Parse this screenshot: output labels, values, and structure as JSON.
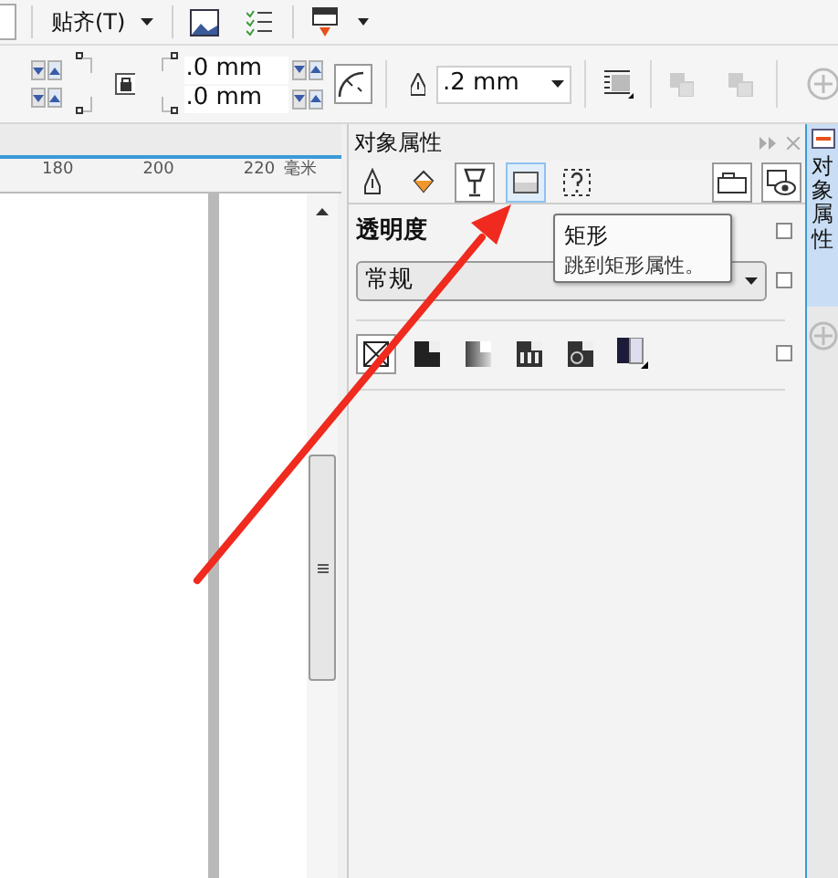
{
  "toolbar": {
    "snap_menu": "贴齐(T)"
  },
  "offset_fields": [
    {
      "value": ".0 mm"
    },
    {
      "value": ".0 mm"
    }
  ],
  "outline_width": ".2 mm",
  "ruler": {
    "labels": [
      "180",
      "200",
      "220"
    ],
    "unit": "毫米"
  },
  "panel": {
    "title": "对象属性",
    "tabs": [
      {
        "kind": "outline",
        "selected": false,
        "hovered": false
      },
      {
        "kind": "fill",
        "selected": false,
        "hovered": false
      },
      {
        "kind": "transparency",
        "selected": true,
        "hovered": false
      },
      {
        "kind": "rectangle",
        "selected": false,
        "hovered": true
      },
      {
        "kind": "summary",
        "selected": false,
        "hovered": false
      }
    ],
    "section": "透明度",
    "mode": "常规",
    "transparency_types": [
      {
        "kind": "none",
        "selected": true
      },
      {
        "kind": "uniform",
        "selected": false
      },
      {
        "kind": "fountain",
        "selected": false
      },
      {
        "kind": "vector",
        "selected": false
      },
      {
        "kind": "bitmap",
        "selected": false
      },
      {
        "kind": "texture",
        "selected": false
      }
    ],
    "row_checkboxes": [
      {
        "checked": false
      },
      {
        "checked": false
      },
      {
        "checked": false
      }
    ]
  },
  "tooltip": {
    "title": "矩形",
    "text": "跳到矩形属性。"
  },
  "docker_tab": {
    "label": "对象属性",
    "selected": true
  }
}
